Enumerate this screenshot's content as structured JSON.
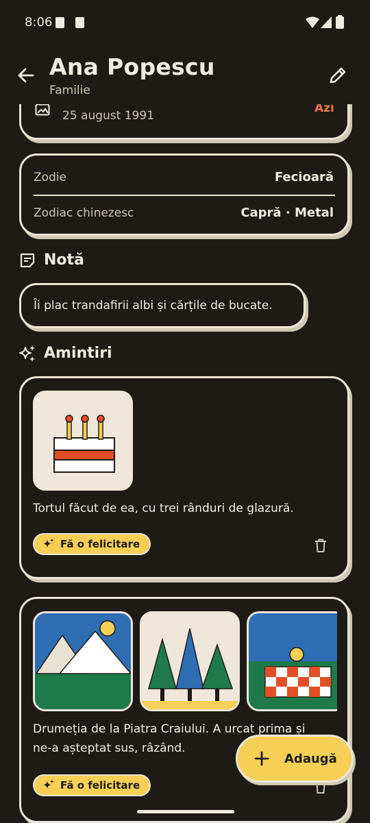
{
  "status_bar": {
    "time": "8:06"
  },
  "header": {
    "title": "Ana Popescu",
    "subtitle": "Familie"
  },
  "birthday_card": {
    "date": "25 august 1991",
    "badge": "Azi"
  },
  "zodiac_card": {
    "rows": [
      {
        "label": "Zodie",
        "value": "Fecioară"
      },
      {
        "label": "Zodiac chinezesc",
        "value": "Capră · Metal"
      }
    ]
  },
  "note_section": {
    "title": "Notă",
    "text": "Îi plac trandafirii albi și cărțile de bucate."
  },
  "memories_section": {
    "title": "Amintiri",
    "items": [
      {
        "text": "Tortul făcut de ea, cu trei rânduri de glazură.",
        "action": "Fă o felicitare"
      },
      {
        "text_line1": "Drumeția de la Piatra Craiului. A urcat prima și",
        "text_line2": "ne-a așteptat sus, râzând.",
        "action": "Fă o felicitare"
      }
    ]
  },
  "fab": {
    "label": "Adaugă"
  },
  "colors": {
    "background": "#1e1b16",
    "card_border": "#ece6d7",
    "accent_yellow": "#f5cf56",
    "badge_orange": "#e8734f"
  }
}
